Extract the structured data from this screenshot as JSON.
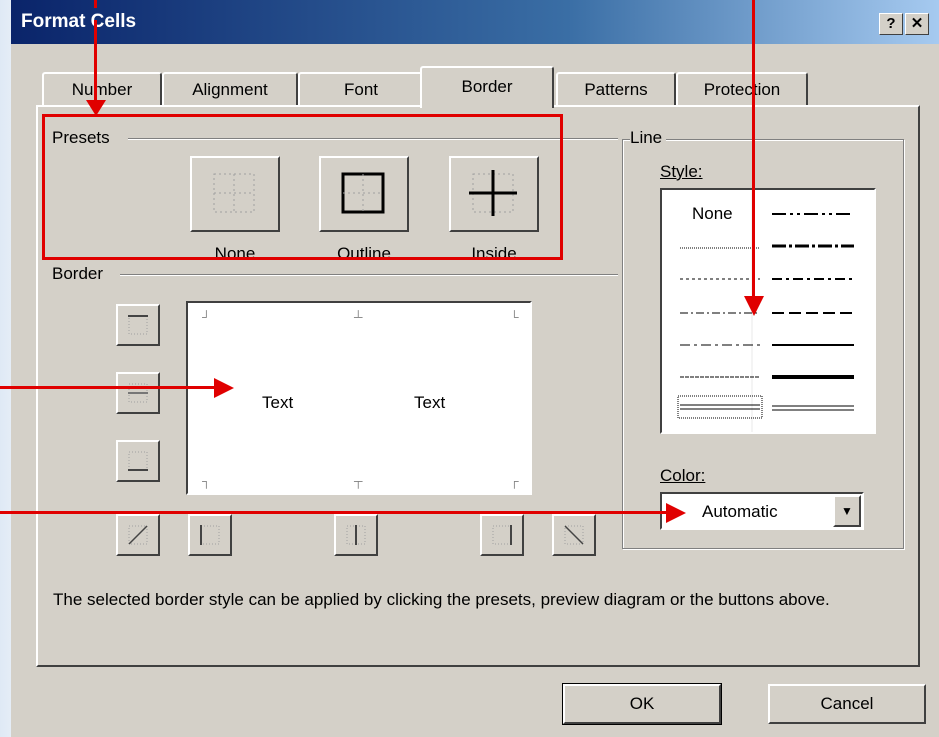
{
  "window": {
    "title": "Format Cells",
    "help_label": "?",
    "close_label": "✕"
  },
  "tabs": [
    {
      "label": "Number",
      "active": false
    },
    {
      "label": "Alignment",
      "active": false
    },
    {
      "label": "Font",
      "active": false
    },
    {
      "label": "Border",
      "active": true
    },
    {
      "label": "Patterns",
      "active": false
    },
    {
      "label": "Protection",
      "active": false
    }
  ],
  "presets": {
    "group_label": "Presets",
    "items": [
      {
        "label": "None",
        "icon": "preset-none-icon"
      },
      {
        "label": "Outline",
        "icon": "preset-outline-icon"
      },
      {
        "label": "Inside",
        "icon": "preset-inside-icon"
      }
    ]
  },
  "border": {
    "group_label": "Border",
    "preview_text_left": "Text",
    "preview_text_right": "Text",
    "buttons_left": [
      "border-top-icon",
      "border-middle-horizontal-icon",
      "border-bottom-icon"
    ],
    "buttons_bottom": [
      "diagonal-up-icon",
      "border-left-icon",
      "border-middle-vertical-icon",
      "border-right-icon",
      "diagonal-down-icon"
    ]
  },
  "line": {
    "group_label": "Line",
    "style_label": "Style:",
    "none_label": "None",
    "color_label": "Color:",
    "color_value": "Automatic"
  },
  "description": "The selected border style can be applied by clicking the presets, preview diagram or the buttons above.",
  "footer": {
    "ok_label": "OK",
    "cancel_label": "Cancel"
  },
  "colors": {
    "dialog_face": "#d4d0c8",
    "title_start": "#0a246a",
    "title_end": "#a6caf0",
    "annotation_red": "#e00000"
  }
}
